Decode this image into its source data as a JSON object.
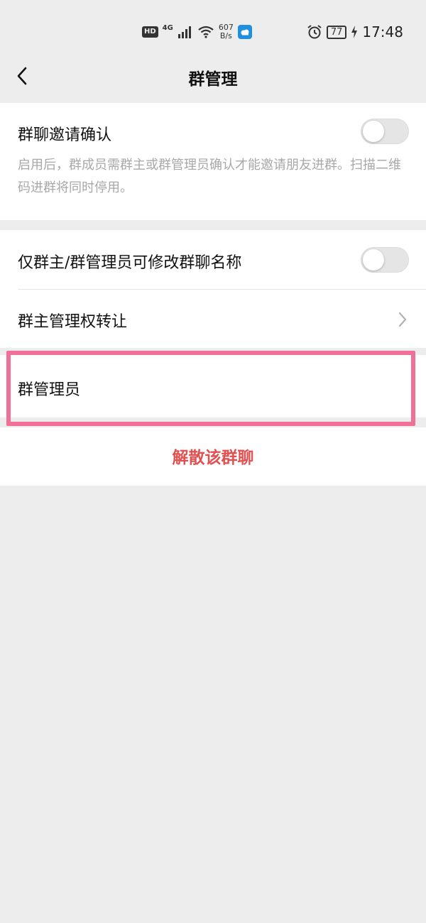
{
  "status_bar": {
    "hd_badge": "HD",
    "network": "4G",
    "speed_value": "607",
    "speed_unit": "B/s",
    "battery": "77",
    "time": "17:48",
    "icons": [
      "signal-icon",
      "wifi-icon",
      "weather-icon",
      "alarm-icon",
      "charging-icon"
    ]
  },
  "nav": {
    "title": "群管理",
    "back_icon": "chevron-left-icon"
  },
  "settings": {
    "invite_confirm": {
      "label": "群聊邀请确认",
      "description": "启用后，群成员需群主或群管理员确认才能邀请朋友进群。扫描二维码进群将同时停用。",
      "enabled": false
    },
    "admin_rename_only": {
      "label": "仅群主/群管理员可修改群聊名称",
      "enabled": false
    },
    "transfer_owner": {
      "label": "群主管理权转让"
    },
    "group_admins": {
      "label": "群管理员"
    }
  },
  "dissolve_label": "解散该群聊",
  "colors": {
    "background": "#ededed",
    "highlight": "#f07097",
    "danger": "#e25050"
  }
}
